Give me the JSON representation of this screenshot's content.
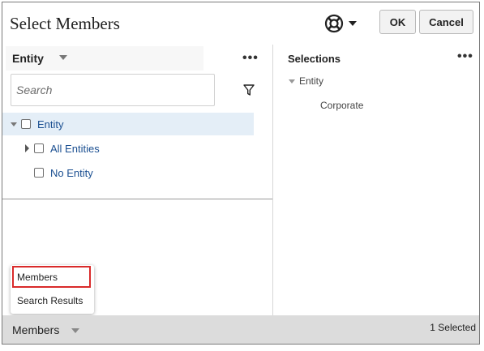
{
  "dialog": {
    "title": "Select Members",
    "ok_label": "OK",
    "cancel_label": "Cancel"
  },
  "left_panel": {
    "dimension_label": "Entity",
    "more_menu": "•••",
    "search_placeholder": "Search",
    "tree": [
      {
        "label": "Entity",
        "expanded": true,
        "checked": false
      },
      {
        "label": "All Entities",
        "expanded": false,
        "checked": false
      },
      {
        "label": "No Entity",
        "checked": false
      }
    ]
  },
  "right_panel": {
    "title": "Selections",
    "more_menu": "•••",
    "entity_label": "Entity",
    "member": "Corporate"
  },
  "view_menu": {
    "items": [
      "Members",
      "Search Results"
    ],
    "highlighted": "Members"
  },
  "footer": {
    "view_label": "Members",
    "selected_count": "1 Selected"
  },
  "icons": {
    "help": "lifebuoy-icon",
    "filter": "filter-funnel-icon"
  },
  "colors": {
    "link_blue": "#1b4f91",
    "row_highlight": "#e4eef7",
    "menu_highlight_border": "#d92b2b",
    "footer_bg": "#dcdcdc"
  }
}
